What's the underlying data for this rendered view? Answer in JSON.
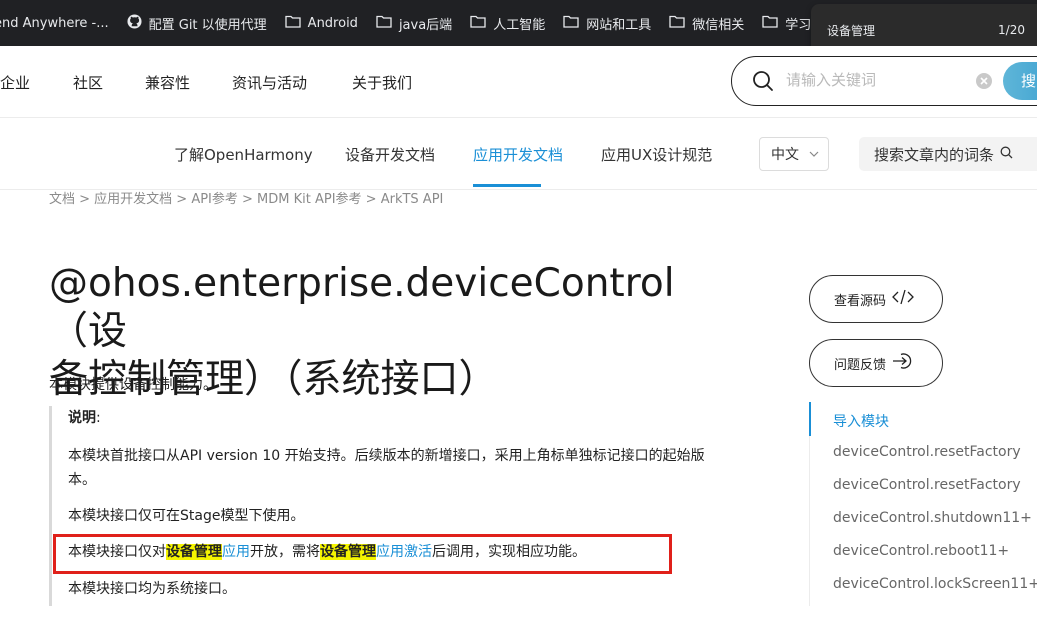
{
  "bookmarks": [
    {
      "label": "end Anywhere -...",
      "icon": "none"
    },
    {
      "label": "配置 Git 以使用代理",
      "icon": "github-icon"
    },
    {
      "label": "Android",
      "icon": "folder-icon"
    },
    {
      "label": "java后端",
      "icon": "folder-icon"
    },
    {
      "label": "人工智能",
      "icon": "folder-icon"
    },
    {
      "label": "网站和工具",
      "icon": "folder-icon"
    },
    {
      "label": "微信相关",
      "icon": "folder-icon"
    },
    {
      "label": "学习网站",
      "icon": "folder-icon"
    }
  ],
  "find_bar": {
    "query": "设备管理",
    "count": "1/20"
  },
  "top_nav": {
    "links": [
      "企业",
      "社区",
      "兼容性",
      "资讯与活动",
      "关于我们"
    ],
    "search_placeholder": "请输入关键词",
    "search_button": "搜"
  },
  "sub_nav": {
    "tabs": [
      "了解OpenHarmony",
      "设备开发文档",
      "应用开发文档",
      "应用UX设计规范"
    ],
    "active_tab": "应用开发文档",
    "language": "中文",
    "doc_search": "搜索文章内的词条"
  },
  "breadcrumb": "文档 > 应用开发文档 > API参考 > MDM Kit API参考 > ArkTS API",
  "title_line1": "@ohos.enterprise.deviceControl（设",
  "title_line2": "备控制管理）（系统接口）",
  "intro": "本模块提供设备控制能力。",
  "note": {
    "heading": "说明",
    "colon": ":",
    "p1": "本模块首批接口从API version 10 开始支持。后续版本的新增接口，采用上角标单独标记接口的起始版本。",
    "p2": "本模块接口仅可在Stage模型下使用。",
    "p3_a": "本模块接口仅对",
    "p3_hl1": "设备管理",
    "p3_link1": "应用",
    "p3_b": "开放，需将",
    "p3_hl2": "设备管理",
    "p3_link2": "应用激活",
    "p3_c": "后调用，实现相应功能。",
    "p4": "本模块接口均为系统接口。"
  },
  "side_buttons": {
    "view_source": "查看源码",
    "feedback": "问题反馈"
  },
  "toc": [
    "导入模块",
    "deviceControl.resetFactory",
    "deviceControl.resetFactory",
    "deviceControl.shutdown11+",
    "deviceControl.reboot11+",
    "deviceControl.lockScreen11+"
  ],
  "colors": {
    "accent": "#1a8fd6",
    "highlight": "#f5f500",
    "red_box": "#e0201a",
    "bookmark_bar": "#202124"
  }
}
